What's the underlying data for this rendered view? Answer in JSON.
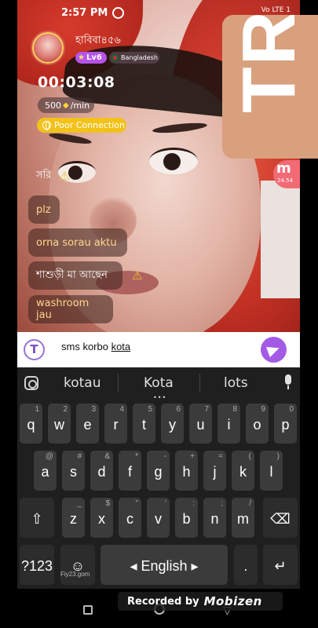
{
  "status_bar": {
    "time": "2:57 PM",
    "indicators": "Vo LTE 1"
  },
  "watermark": {
    "text": "TR"
  },
  "host": {
    "name": "হাবিবা৪৫৬",
    "level": "Lv6",
    "country": "Bangladesh"
  },
  "call": {
    "timer": "00:03:08",
    "rate": "500",
    "rate_unit": "/min",
    "connection": "Poor Connection"
  },
  "side_badge": {
    "letter": "m",
    "count": "24.54"
  },
  "chat": {
    "messages": [
      {
        "text": "সরি",
        "warning": true
      },
      {
        "text": "plz",
        "warning": false
      },
      {
        "text": "orna sorau aktu",
        "warning": false
      },
      {
        "text": "শাশুড়ী মা আছেন",
        "warning": true
      },
      {
        "text": "washroom jau",
        "warning": false
      }
    ]
  },
  "input": {
    "typed": "sms korbo ",
    "composing": "kota"
  },
  "keyboard": {
    "suggestions": [
      "kotau",
      "Kota",
      "lots"
    ],
    "row1": [
      {
        "k": "q",
        "a": "1"
      },
      {
        "k": "w",
        "a": "2"
      },
      {
        "k": "e",
        "a": "3"
      },
      {
        "k": "r",
        "a": "4"
      },
      {
        "k": "t",
        "a": "5"
      },
      {
        "k": "y",
        "a": "6"
      },
      {
        "k": "u",
        "a": "7"
      },
      {
        "k": "i",
        "a": "8"
      },
      {
        "k": "o",
        "a": "9"
      },
      {
        "k": "p",
        "a": "0"
      }
    ],
    "row2": [
      {
        "k": "a",
        "a": "@"
      },
      {
        "k": "s",
        "a": "#"
      },
      {
        "k": "d",
        "a": "&"
      },
      {
        "k": "f",
        "a": "*"
      },
      {
        "k": "g",
        "a": "-"
      },
      {
        "k": "h",
        "a": "+"
      },
      {
        "k": "j",
        "a": "="
      },
      {
        "k": "k",
        "a": "("
      },
      {
        "k": "l",
        "a": ")"
      }
    ],
    "row3": [
      {
        "k": "z",
        "a": "_"
      },
      {
        "k": "x",
        "a": "$"
      },
      {
        "k": "c",
        "a": "\""
      },
      {
        "k": "v",
        "a": "'"
      },
      {
        "k": "b",
        "a": ":"
      },
      {
        "k": "n",
        "a": ";"
      },
      {
        "k": "m",
        "a": "/"
      }
    ],
    "symbols_label": "?123",
    "space_label": "English",
    "period_label": ".",
    "emoji_hint": "Fiy23.gom"
  },
  "overlay": {
    "recorded_by": "Recorded by",
    "brand": "Mobizen"
  }
}
